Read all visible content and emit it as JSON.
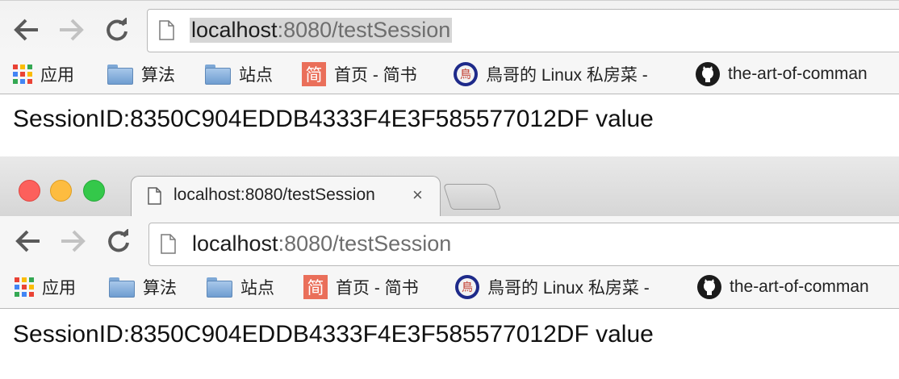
{
  "window1": {
    "url_host": "localhost",
    "url_rest": ":8080/testSession",
    "content_text": "SessionID:8350C904EDDB4333F4E3F585577012DF value"
  },
  "window2": {
    "tab_title": "localhost:8080/testSession",
    "tab_close": "×",
    "url_host": "localhost",
    "url_rest": ":8080/testSession",
    "content_text": "SessionID:8350C904EDDB4333F4E3F585577012DF value"
  },
  "bookmarks": [
    {
      "label": "应用",
      "icon": "apps-grid-icon"
    },
    {
      "label": "算法",
      "icon": "folder-icon"
    },
    {
      "label": "站点",
      "icon": "folder-icon"
    },
    {
      "label": "首页 - 简书",
      "icon": "jianshu-icon",
      "icon_text": "简"
    },
    {
      "label": "鳥哥的 Linux 私房菜 -",
      "icon": "vbird-icon",
      "icon_text": "鳥"
    },
    {
      "label": "the-art-of-comman",
      "icon": "github-icon"
    }
  ],
  "colors": {
    "traffic_red": "#fc605c",
    "traffic_yellow": "#fdbc40",
    "traffic_green": "#34c84a",
    "jianshu_red": "#ea6f5a",
    "url_selection": "#d6d6d6"
  }
}
